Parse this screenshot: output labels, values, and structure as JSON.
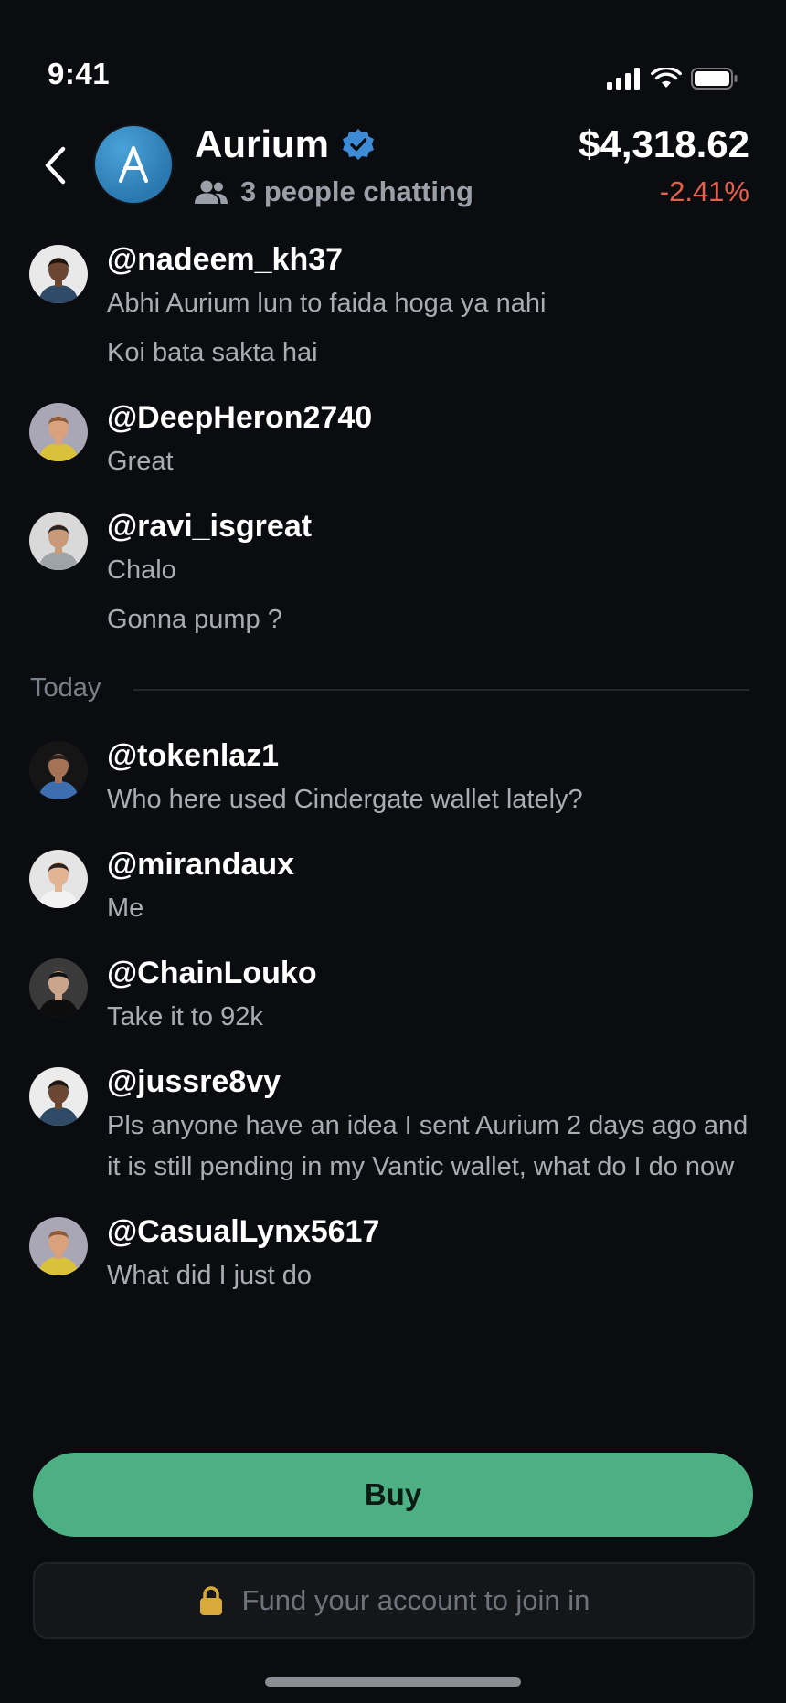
{
  "status_bar": {
    "time": "9:41"
  },
  "header": {
    "coin_name": "Aurium",
    "avatar_letter": "A",
    "chatting_text": "3 people chatting",
    "price": "$4,318.62",
    "change": "-2.41%",
    "change_color": "#e8604c"
  },
  "messages_before": [
    {
      "username": "@nadeem_kh37",
      "lines": [
        "Abhi Aurium lun to faida hoga ya nahi",
        "Koi bata sakta hai"
      ]
    },
    {
      "username": "@DeepHeron2740",
      "lines": [
        "Great"
      ]
    },
    {
      "username": "@ravi_isgreat",
      "lines": [
        "Chalo",
        "Gonna pump ?"
      ]
    }
  ],
  "divider": {
    "label": "Today"
  },
  "messages_after": [
    {
      "username": "@tokenlaz1",
      "lines": [
        "Who here used Cindergate wallet lately?"
      ]
    },
    {
      "username": "@mirandaux",
      "lines": [
        "Me"
      ]
    },
    {
      "username": "@ChainLouko",
      "lines": [
        "Take it to 92k"
      ]
    },
    {
      "username": "@jussre8vy",
      "lines": [
        "Pls anyone have an idea I sent Aurium 2 days ago and it is still pending in my Vantic wallet, what do I do now"
      ]
    },
    {
      "username": "@CasualLynx5617",
      "lines": [
        "What did I just do"
      ]
    }
  ],
  "actions": {
    "buy_label": "Buy",
    "buy_color": "#4daf84",
    "fund_label": "Fund your account to join in"
  },
  "icons": [
    "back-icon",
    "verified-icon",
    "people-icon",
    "lock-icon",
    "signal-icon",
    "wifi-icon",
    "battery-icon"
  ]
}
